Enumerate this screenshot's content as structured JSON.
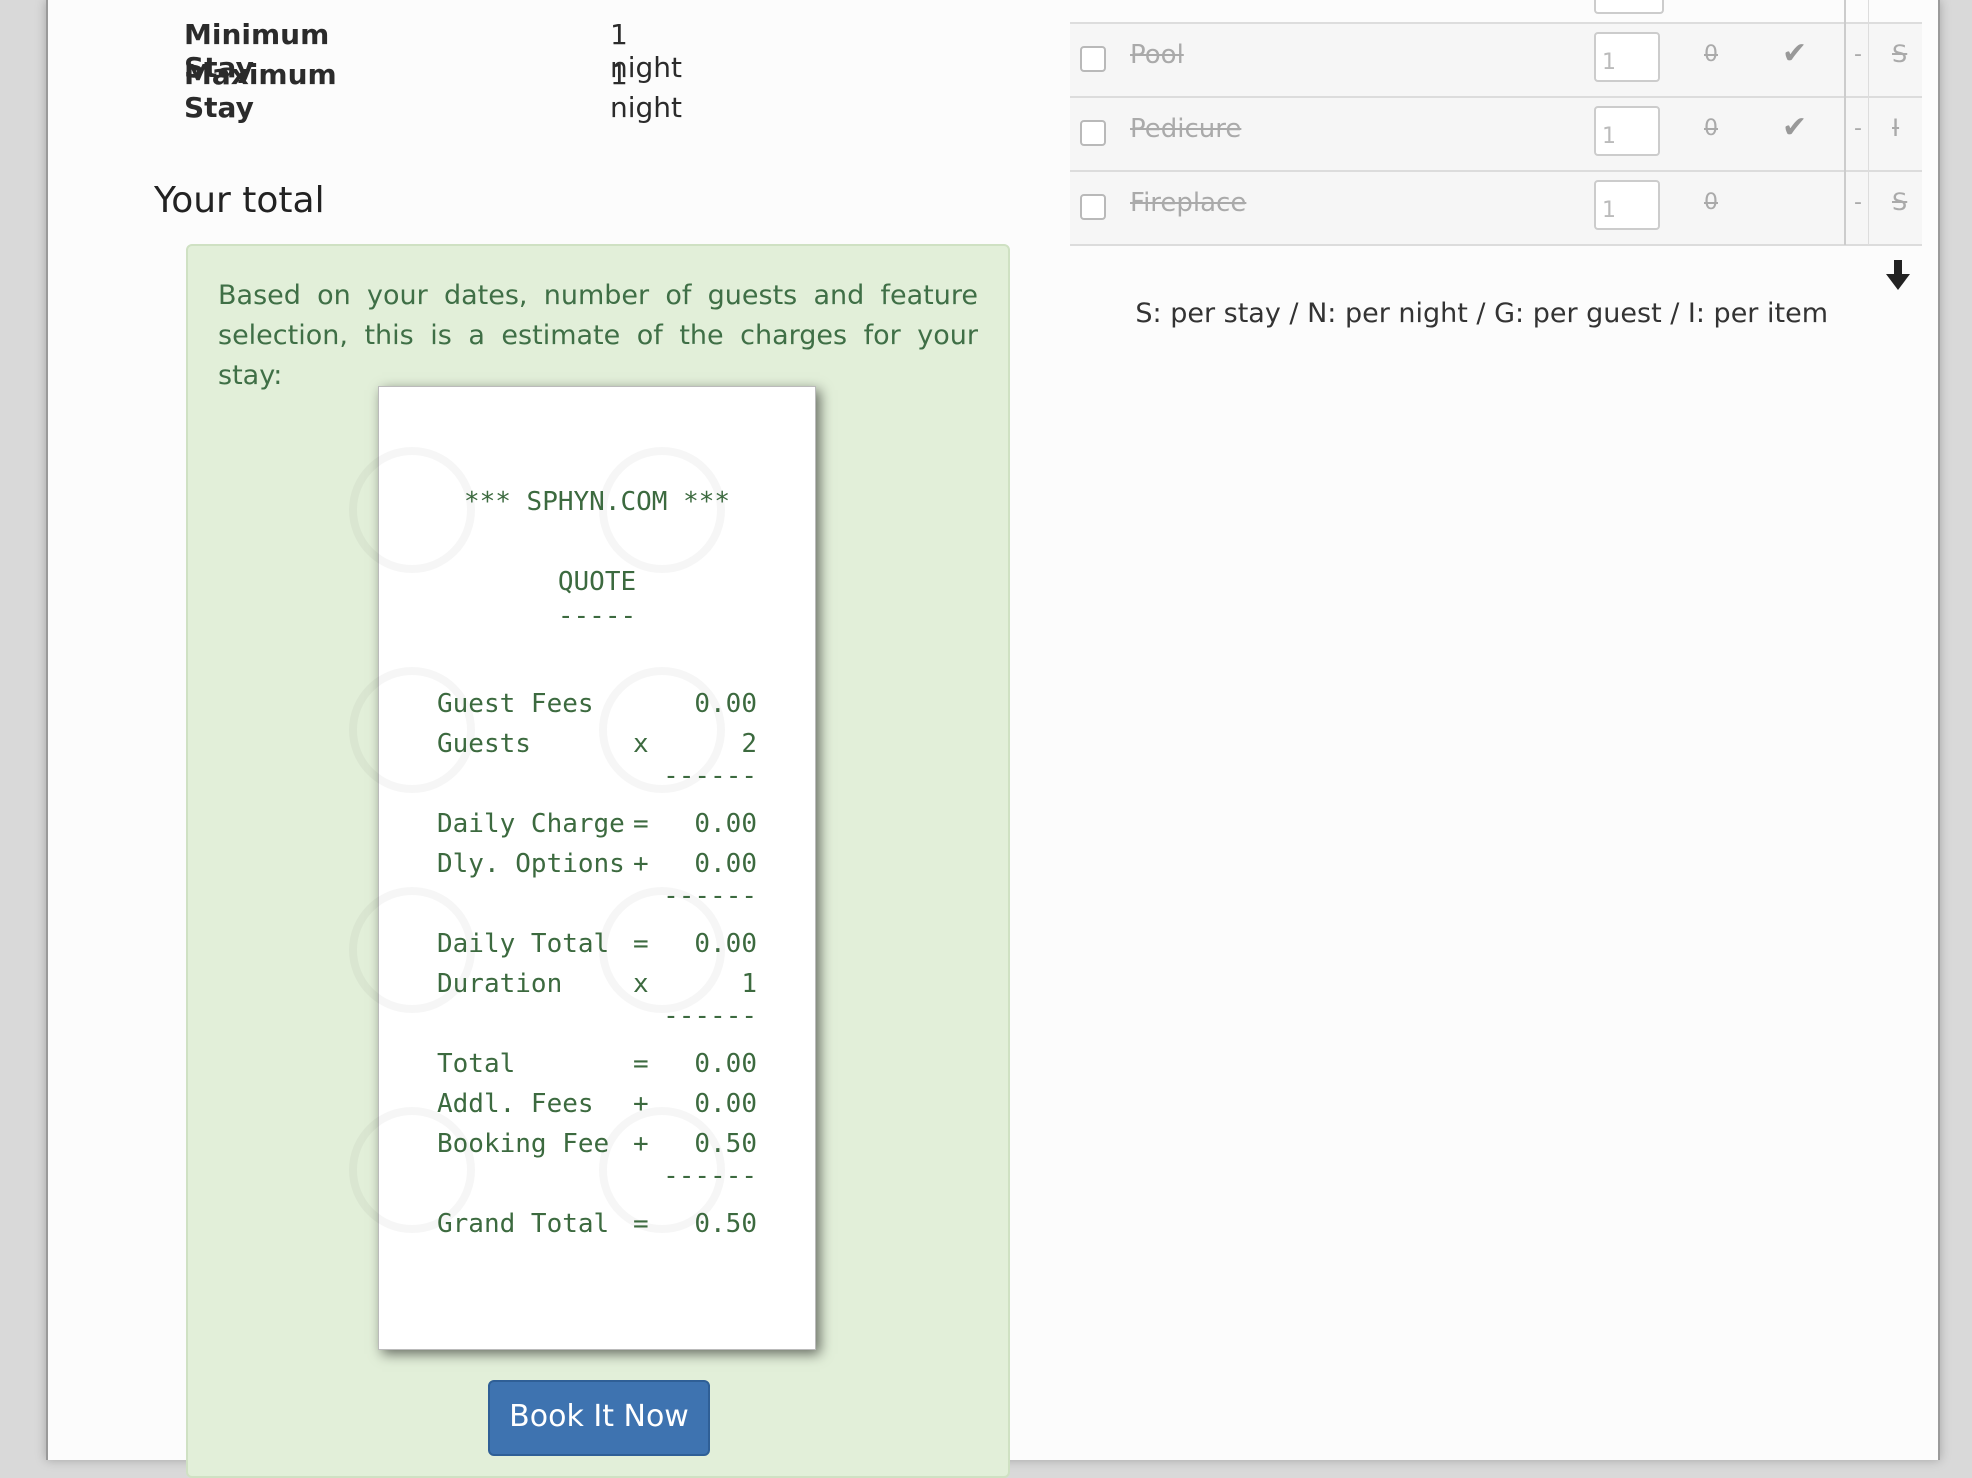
{
  "stay": {
    "min_label": "Minimum Stay",
    "min_value": "1 night",
    "max_label": "Maximum Stay",
    "max_value": "1 night"
  },
  "total_heading": "Your total",
  "quote": {
    "intro": "Based on your dates, number of guests and feature selection, this is a estimate of the charges for your stay:",
    "receipt": {
      "header": "*** SPHYN.COM ***",
      "title": "QUOTE",
      "title_rule": "-----",
      "lines": [
        {
          "label": "Guest Fees",
          "op": "",
          "value": "0.00"
        },
        {
          "label": "Guests",
          "op": "x",
          "value": "2"
        },
        {
          "label": "Daily Charge",
          "op": "=",
          "value": "0.00"
        },
        {
          "label": "Dly. Options",
          "op": "+",
          "value": "0.00"
        },
        {
          "label": "Daily Total",
          "op": "=",
          "value": "0.00"
        },
        {
          "label": "Duration",
          "op": "x",
          "value": "1"
        },
        {
          "label": "Total",
          "op": "=",
          "value": "0.00"
        },
        {
          "label": "Addl. Fees",
          "op": "+",
          "value": "0.00"
        },
        {
          "label": "Booking Fee",
          "op": "+",
          "value": "0.50"
        },
        {
          "label": "Grand Total",
          "op": "=",
          "value": "0.50"
        }
      ],
      "separator": "------"
    },
    "book_button": "Book It Now"
  },
  "options": [
    {
      "name": "Pool",
      "qty": "1",
      "price": "0",
      "included": true,
      "dash": "-",
      "unit": "S"
    },
    {
      "name": "Pedicure",
      "qty": "1",
      "price": "0",
      "included": true,
      "dash": "-",
      "unit": "I"
    },
    {
      "name": "Fireplace",
      "qty": "1",
      "price": "0",
      "included": false,
      "dash": "-",
      "unit": "S"
    }
  ],
  "legend": "S: per stay / N: per night / G: per guest / I: per item",
  "colors": {
    "quote_bg": "#e2efd9",
    "quote_text": "#3f6f46",
    "receipt_text": "#3c6a3f",
    "button_bg": "#3e73b0"
  }
}
